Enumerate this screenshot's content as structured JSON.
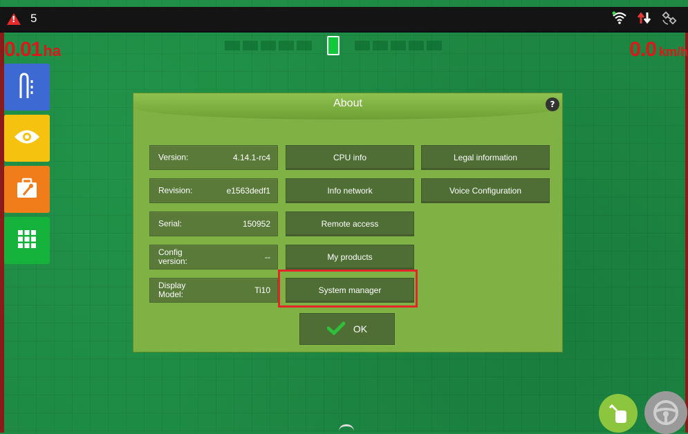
{
  "alerts": {
    "count": "5"
  },
  "readouts": {
    "area_value": "0.01",
    "area_unit": "ha",
    "speed_value": "0.0",
    "speed_unit": "km/h"
  },
  "dialog": {
    "title": "About",
    "help": "?",
    "info": [
      {
        "label": "Version:",
        "value": "4.14.1-rc4"
      },
      {
        "label": "Revision:",
        "value": "e1563dedf1"
      },
      {
        "label": "Serial:",
        "value": "150952"
      },
      {
        "label": "Config version:",
        "value": "--"
      },
      {
        "label": "Display Model:",
        "value": "Ti10"
      }
    ],
    "buttons_col2": [
      "CPU info",
      "Info network",
      "Remote access",
      "My products",
      "System manager"
    ],
    "buttons_col3": [
      "Legal information",
      "Voice Configuration"
    ],
    "ok_label": "OK"
  },
  "colors": {
    "alert_red": "#e52b2b",
    "readout_red": "#d91a1a",
    "dialog_green": "#7fb144",
    "button_green": "#4f6e36",
    "highlight_red": "#e3252a"
  },
  "icons": {
    "toolbar": [
      "guidance-icon",
      "view-icon",
      "toolbox-icon",
      "apps-grid-icon"
    ],
    "status": [
      "wifi-icon",
      "data-transfer-icon",
      "gps-satellite-icon"
    ],
    "bottom": [
      "tool-hand-icon",
      "steering-wheel-icon"
    ]
  }
}
